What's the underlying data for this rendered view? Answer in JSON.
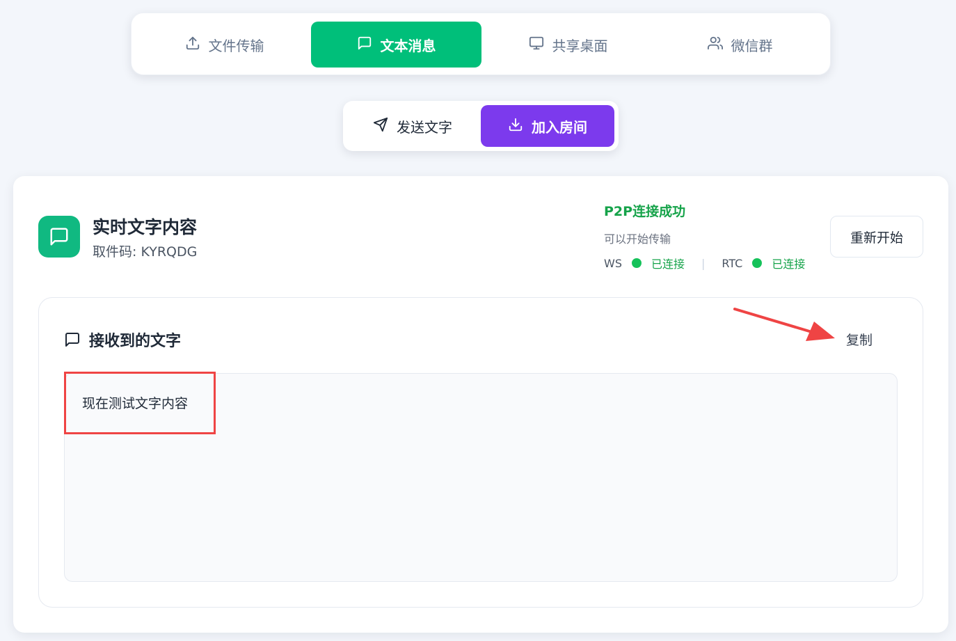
{
  "main_tabs": [
    {
      "label": "文件传输",
      "icon": "upload-icon",
      "active": false
    },
    {
      "label": "文本消息",
      "icon": "message-square-icon",
      "active": true
    },
    {
      "label": "共享桌面",
      "icon": "monitor-icon",
      "active": false
    },
    {
      "label": "微信群",
      "icon": "users-icon",
      "active": false
    }
  ],
  "sub_tabs": [
    {
      "label": "发送文字",
      "icon": "send-icon",
      "active": false
    },
    {
      "label": "加入房间",
      "icon": "download-icon",
      "active": true
    }
  ],
  "card": {
    "title": "实时文字内容",
    "pickup_code": "取件码: KYRQDG",
    "status": {
      "title": "P2P连接成功",
      "subtitle": "可以开始传输",
      "ws_label": "WS",
      "ws_state": "已连接",
      "separator": "|",
      "rtc_label": "RTC",
      "rtc_state": "已连接"
    },
    "restart_label": "重新开始",
    "panel": {
      "title": "接收到的文字",
      "copy_label": "复制",
      "content": "现在测试文字内容"
    }
  },
  "colors": {
    "main_tab_active": "#00bf7a",
    "sub_tab_active": "#7c3aed",
    "badge": "#10b981",
    "status_green": "#16a34a",
    "annotation_red": "#ef4444"
  }
}
